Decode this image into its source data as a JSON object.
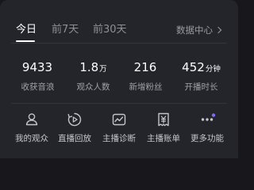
{
  "tabs": {
    "today": "今日",
    "last7": "前7天",
    "last30": "前30天",
    "data_center": "数据中心"
  },
  "stats": [
    {
      "value": "9433",
      "unit": "",
      "label": "收获音浪"
    },
    {
      "value": "1.8",
      "unit": "万",
      "label": "观众人数"
    },
    {
      "value": "216",
      "unit": "",
      "label": "新增粉丝"
    },
    {
      "value": "452",
      "unit": "分钟",
      "label": "开播时长"
    }
  ],
  "actions": [
    {
      "label": "我的观众",
      "icon": "audience-icon"
    },
    {
      "label": "直播回放",
      "icon": "replay-icon"
    },
    {
      "label": "主播诊断",
      "icon": "diagnosis-icon"
    },
    {
      "label": "主播账单",
      "icon": "bill-icon"
    },
    {
      "label": "更多功能",
      "icon": "more-icon"
    }
  ],
  "colors": {
    "background": "#17171c",
    "card": "#24242b",
    "accent_dot": "#7b6ef6"
  }
}
